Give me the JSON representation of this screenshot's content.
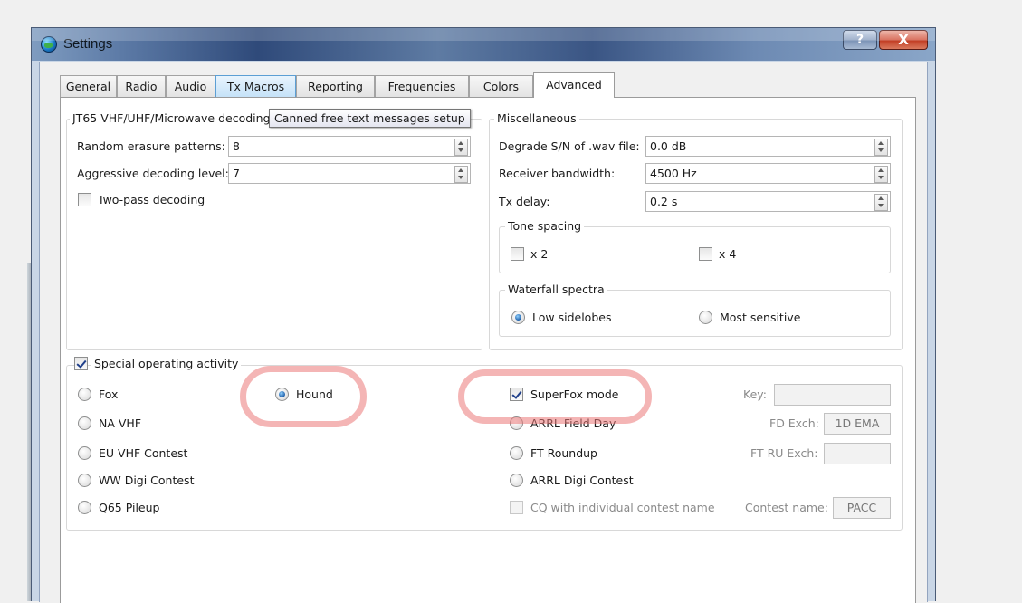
{
  "window": {
    "title": "Settings",
    "help_label": "?",
    "close_label": "X"
  },
  "tabs": [
    {
      "label": "General"
    },
    {
      "label": "Radio"
    },
    {
      "label": "Audio"
    },
    {
      "label": "Tx Macros"
    },
    {
      "label": "Reporting"
    },
    {
      "label": "Frequencies"
    },
    {
      "label": "Colors"
    },
    {
      "label": "Advanced"
    }
  ],
  "tooltip": "Canned free text messages setup",
  "jt65": {
    "title": "JT65 VHF/UHF/Microwave decoding",
    "random_erasure_label": "Random erasure patterns:",
    "random_erasure_value": "8",
    "aggressive_label": "Aggressive decoding level:",
    "aggressive_value": "7",
    "two_pass_label": "Two-pass decoding"
  },
  "misc": {
    "title": "Miscellaneous",
    "degrade_label": "Degrade S/N of .wav file:",
    "degrade_value": "0.0 dB",
    "bandwidth_label": "Receiver bandwidth:",
    "bandwidth_value": "4500  Hz",
    "txdelay_label": "Tx delay:",
    "txdelay_value": "0.2  s",
    "tone_spacing": {
      "title": "Tone spacing",
      "x2_label": "x 2",
      "x4_label": "x 4"
    },
    "waterfall": {
      "title": "Waterfall spectra",
      "low_label": "Low sidelobes",
      "most_label": "Most sensitive"
    }
  },
  "special": {
    "title": "Special operating activity",
    "fox": "Fox",
    "hound": "Hound",
    "na_vhf": "NA VHF",
    "eu_vhf": "EU VHF Contest",
    "ww_digi": "WW Digi Contest",
    "q65": "Q65 Pileup",
    "superfox": "SuperFox mode",
    "arrl_field_day": "ARRL Field Day",
    "ft_roundup": "FT Roundup",
    "arrl_digi": "ARRL Digi Contest",
    "cq_individual": "CQ with individual contest name",
    "key_label": "Key:",
    "fd_exch_label": "FD Exch:",
    "fd_exch_value": "1D EMA",
    "ft_ru_label": "FT RU Exch:",
    "contest_name_label": "Contest name:",
    "contest_name_value": "PACC"
  }
}
